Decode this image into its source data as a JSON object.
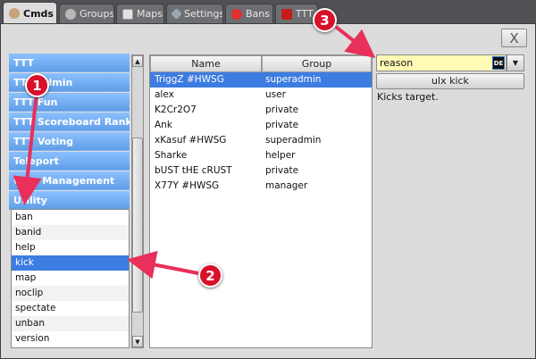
{
  "tabs": [
    {
      "label": "Cmds",
      "icon": "person-icon",
      "active": true
    },
    {
      "label": "Groups",
      "icon": "group-icon"
    },
    {
      "label": "Maps",
      "icon": "map-icon"
    },
    {
      "label": "Settings",
      "icon": "wrench-icon"
    },
    {
      "label": "Bans",
      "icon": "ban-icon"
    },
    {
      "label": "TTT",
      "icon": "ttt-icon"
    }
  ],
  "close_button": {
    "label": "X"
  },
  "categories": [
    "TTT",
    "TTT Admin",
    "TTT Fun",
    "TTT Scoreboard Ranks",
    "TTT Voting",
    "Teleport",
    "User Management",
    "Utility"
  ],
  "commands": [
    "ban",
    "banid",
    "help",
    "kick",
    "map",
    "noclip",
    "spectate",
    "unban",
    "version"
  ],
  "selected_command": "kick",
  "scroll": {
    "up_icon": "▲",
    "down_icon": "▼"
  },
  "players_table": {
    "columns": [
      "Name",
      "Group"
    ],
    "rows": [
      {
        "name": "TriggZ #HWSG",
        "group": "superadmin",
        "selected": true
      },
      {
        "name": "alex",
        "group": "user"
      },
      {
        "name": "K2Cr2O7",
        "group": "private"
      },
      {
        "name": "Ank",
        "group": "private"
      },
      {
        "name": "xKasuf #HWSG",
        "group": "superadmin"
      },
      {
        "name": "Sharke",
        "group": "helper"
      },
      {
        "name": "bUST tHE cRUST",
        "group": "private"
      },
      {
        "name": "X77Y #HWSG",
        "group": "manager"
      }
    ]
  },
  "command_panel": {
    "arg_value": "reason",
    "arg_badge": "DE",
    "dropdown_icon": "▼",
    "run_label": "ulx kick",
    "help_text": "Kicks target."
  },
  "annotations": [
    {
      "num": "1",
      "color": "#d8102a"
    },
    {
      "num": "2",
      "color": "#d8102a"
    },
    {
      "num": "3",
      "color": "#d8102a"
    }
  ]
}
